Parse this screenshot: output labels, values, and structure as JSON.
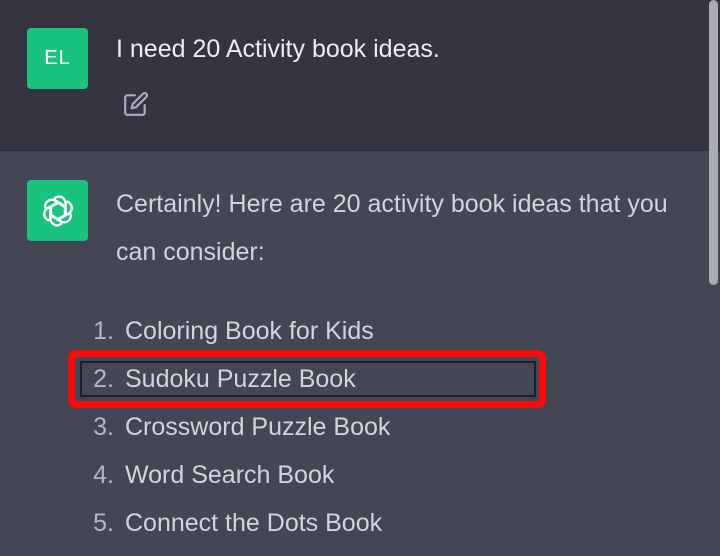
{
  "user": {
    "avatar_initials": "EL",
    "message": "I need 20 Activity book ideas.",
    "edit_icon": "edit-icon"
  },
  "assistant": {
    "avatar_icon": "openai-logo-icon",
    "intro": "Certainly! Here are 20 activity book ideas that you can consider:",
    "ideas": [
      {
        "number": "1.",
        "text": "Coloring Book for Kids"
      },
      {
        "number": "2.",
        "text": "Sudoku Puzzle Book"
      },
      {
        "number": "3.",
        "text": "Crossword Puzzle Book"
      },
      {
        "number": "4.",
        "text": "Word Search Book"
      },
      {
        "number": "5.",
        "text": "Connect the Dots Book"
      }
    ]
  },
  "colors": {
    "user_bg": "#343541",
    "assistant_bg": "#444654",
    "avatar_green": "#19c37d",
    "highlight_red": "#f70c0c"
  },
  "annotation": {
    "highlighted_item": "2."
  }
}
